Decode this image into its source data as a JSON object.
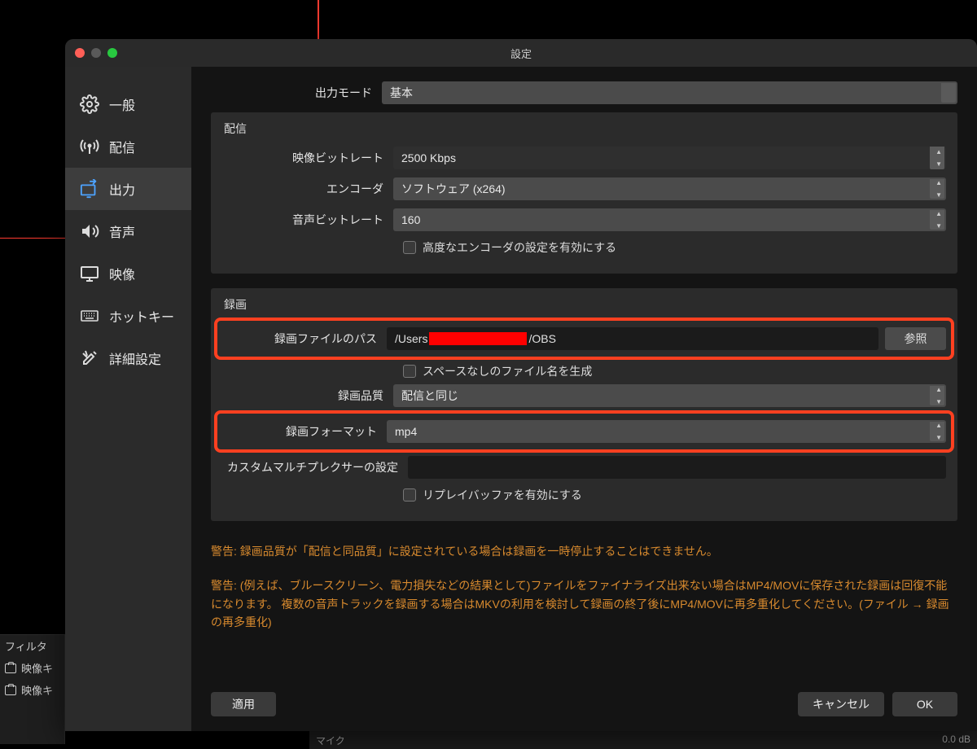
{
  "window": {
    "title": "設定"
  },
  "sidebar": {
    "items": [
      {
        "label": "一般"
      },
      {
        "label": "配信"
      },
      {
        "label": "出力"
      },
      {
        "label": "音声"
      },
      {
        "label": "映像"
      },
      {
        "label": "ホットキー"
      },
      {
        "label": "詳細設定"
      }
    ]
  },
  "output_mode": {
    "label": "出力モード",
    "value": "基本"
  },
  "stream_group": {
    "title": "配信",
    "video_bitrate_label": "映像ビットレート",
    "video_bitrate_value": "2500 Kbps",
    "encoder_label": "エンコーダ",
    "encoder_value": "ソフトウェア (x264)",
    "audio_bitrate_label": "音声ビットレート",
    "audio_bitrate_value": "160",
    "advanced_checkbox": "高度なエンコーダの設定を有効にする"
  },
  "record_group": {
    "title": "録画",
    "path_label": "録画ファイルのパス",
    "path_value_prefix": "/Users",
    "path_value_suffix": "/OBS",
    "browse": "参照",
    "nospace_checkbox": "スペースなしのファイル名を生成",
    "quality_label": "録画品質",
    "quality_value": "配信と同じ",
    "format_label": "録画フォーマット",
    "format_value": "mp4",
    "muxer_label": "カスタムマルチプレクサーの設定",
    "replay_checkbox": "リプレイバッファを有効にする"
  },
  "warnings": {
    "w1": "警告: 録画品質が「配信と同品質」に設定されている場合は録画を一時停止することはできません。",
    "w2": "警告: (例えば、ブルースクリーン、電力損失などの結果として)ファイルをファイナライズ出来ない場合はMP4/MOVに保存された録画は回復不能になります。 複数の音声トラックを録画する場合はMKVの利用を検討して録画の終了後にMP4/MOVに再多重化してください。(ファイル → 録画の再多重化)"
  },
  "footer": {
    "apply": "適用",
    "cancel": "キャンセル",
    "ok": "OK"
  },
  "bg": {
    "filter": "フィルタ",
    "vidcap": "映像キ",
    "mic": "マイク",
    "db": "0.0 dB"
  }
}
